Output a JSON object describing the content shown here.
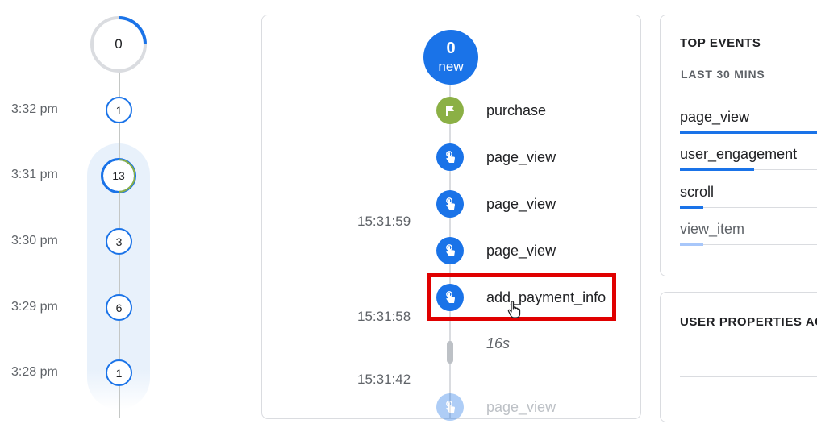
{
  "minute_timeline": {
    "top_count": "0",
    "rows": [
      {
        "time": "3:32 pm",
        "count": "1"
      },
      {
        "time": "3:31 pm",
        "count": "13"
      },
      {
        "time": "3:30 pm",
        "count": "3"
      },
      {
        "time": "3:29 pm",
        "count": "6"
      },
      {
        "time": "3:28 pm",
        "count": "1"
      }
    ]
  },
  "event_stream": {
    "new_count": "0",
    "new_label": "new",
    "events": [
      {
        "name": "purchase",
        "icon": "flag-icon"
      },
      {
        "name": "page_view",
        "icon": "touch-icon"
      },
      {
        "name": "page_view",
        "icon": "touch-icon"
      },
      {
        "name": "page_view",
        "icon": "touch-icon"
      },
      {
        "name": "add_payment_info",
        "icon": "touch-icon"
      },
      {
        "name": "page_view",
        "icon": "touch-icon"
      }
    ],
    "timestamps": [
      "15:31:59",
      "15:31:58",
      "15:31:42"
    ],
    "gap_duration": "16s"
  },
  "top_events": {
    "title": "TOP EVENTS",
    "subtitle": "LAST 30 MINS",
    "items": [
      {
        "name": "page_view",
        "share": 1.0
      },
      {
        "name": "user_engagement",
        "share": 0.54
      },
      {
        "name": "scroll",
        "share": 0.17
      },
      {
        "name": "view_item",
        "share": 0.17
      }
    ]
  },
  "user_properties": {
    "title": "USER PROPERTIES AC"
  },
  "colors": {
    "accent": "#1a73e8",
    "purchase_green": "#8bb045",
    "highlight_red": "#e00000"
  }
}
